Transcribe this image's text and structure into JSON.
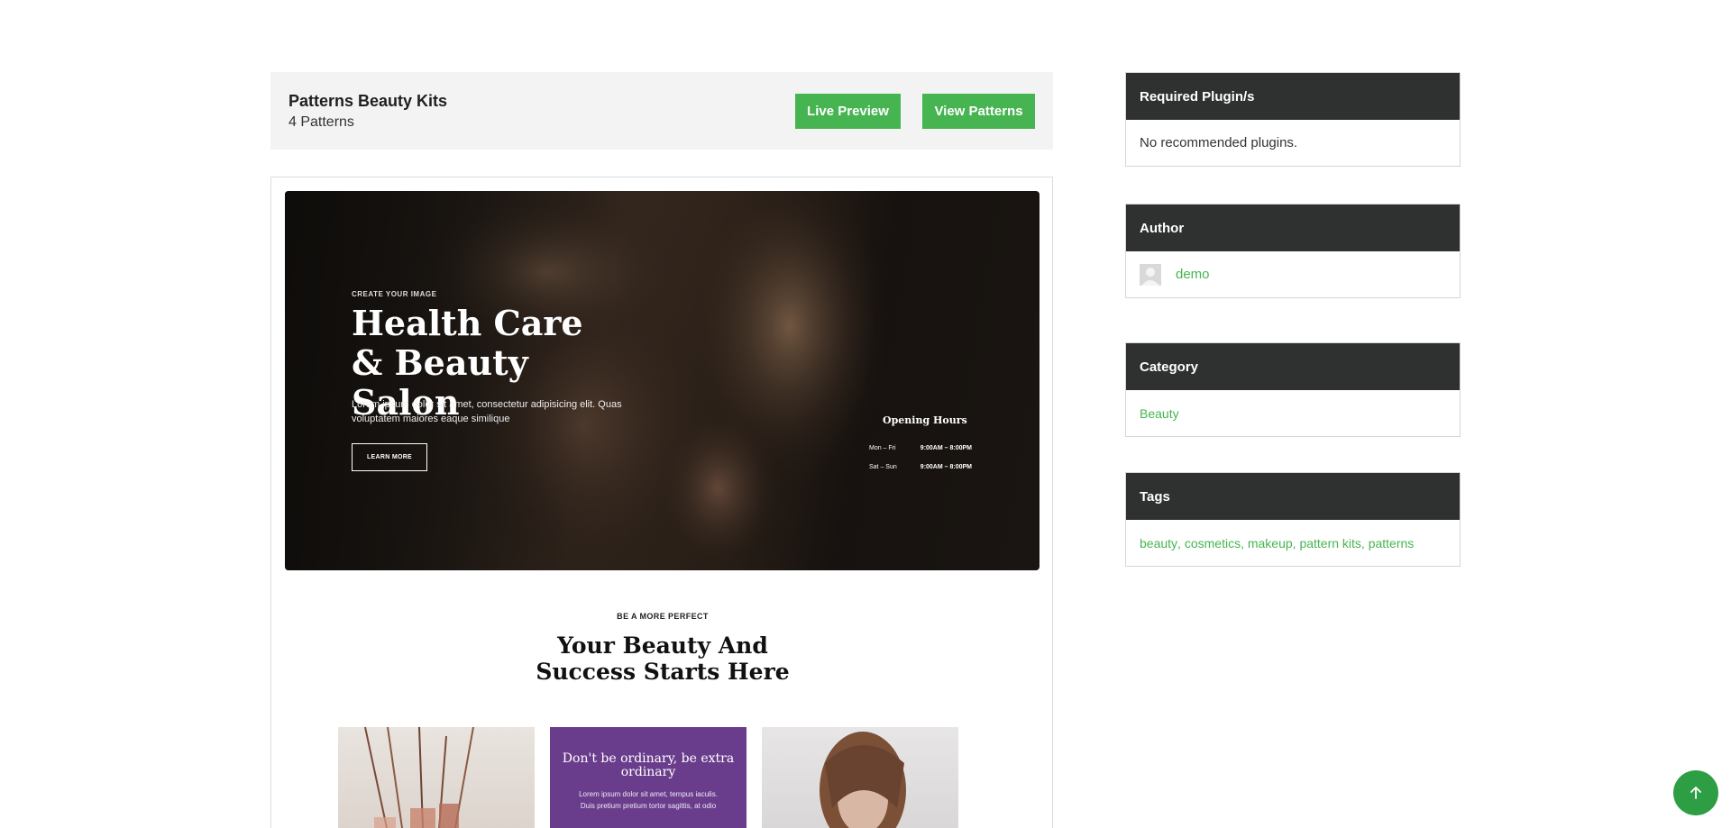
{
  "kit": {
    "title": "Patterns Beauty Kits",
    "count": "4 Patterns",
    "live_preview_label": "Live Preview",
    "view_patterns_label": "View Patterns"
  },
  "preview": {
    "hero": {
      "eyebrow": "CREATE YOUR IMAGE",
      "title": "Health Care & Beauty Salon",
      "description": "Lorem ipsum dolor sit amet, consectetur adipisicing elit. Quas voluptatem maiores eaque similique",
      "button_label": "LEARN MORE",
      "hours_title": "Opening Hours",
      "hours": [
        {
          "days": "Mon – Fri",
          "time": "9:00AM – 8:00PM"
        },
        {
          "days": "Sat – Sun",
          "time": "9:00AM – 8:00PM"
        }
      ]
    },
    "section": {
      "eyebrow": "BE A MORE PERFECT",
      "title": "Your Beauty And Success Starts Here"
    },
    "cards": {
      "purple_title": "Don't be ordinary, be extra ordinary",
      "purple_text": "Lorem ipsum dolor sit amet, tempus iaculis. Duis pretium pretium tortor sagittis, at odio"
    }
  },
  "sidebar": {
    "plugins": {
      "heading": "Required Plugin/s",
      "body": "No recommended plugins."
    },
    "author": {
      "heading": "Author",
      "name": "demo"
    },
    "category": {
      "heading": "Category",
      "value": "Beauty"
    },
    "tags": {
      "heading": "Tags",
      "items": [
        "beauty",
        "cosmetics",
        "makeup",
        "pattern kits",
        "patterns"
      ]
    }
  },
  "colors": {
    "accent": "#46b450",
    "widget_header": "#2f3030",
    "purple_card": "#6a3d8c"
  },
  "icons": {
    "scroll_top": "arrow-up-icon",
    "avatar": "user-placeholder-icon"
  }
}
